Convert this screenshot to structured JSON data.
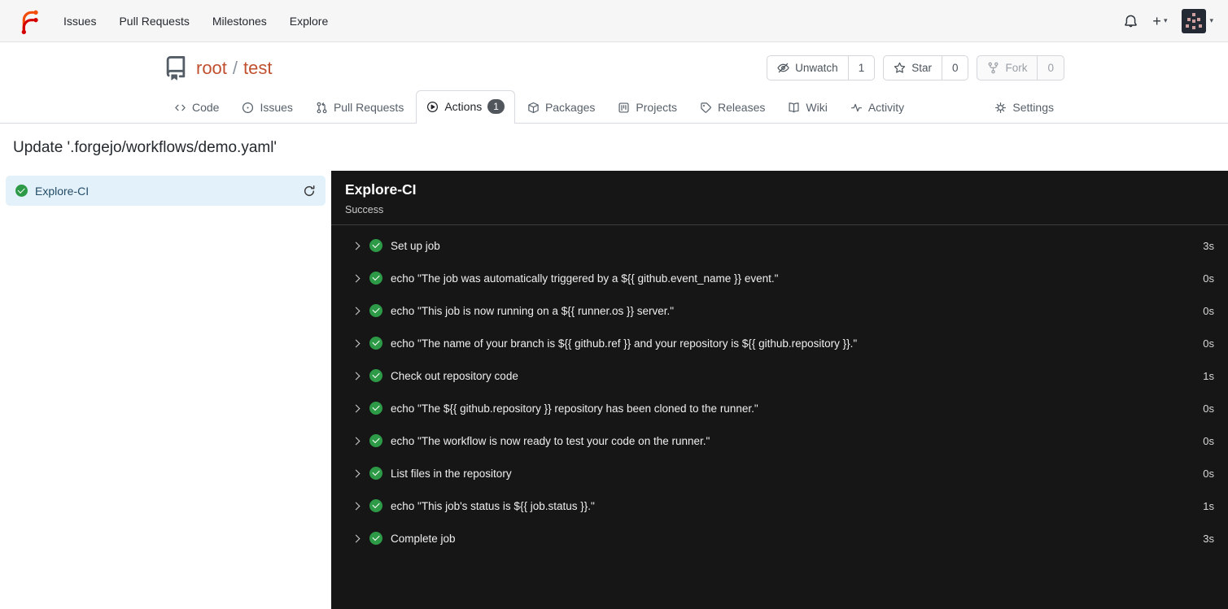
{
  "icons": {
    "caret_down": "▾",
    "plus": "+"
  },
  "navbar": {
    "items": [
      {
        "label": "Issues"
      },
      {
        "label": "Pull Requests"
      },
      {
        "label": "Milestones"
      },
      {
        "label": "Explore"
      }
    ]
  },
  "repo": {
    "owner": "root",
    "separator": "/",
    "name": "test"
  },
  "repo_actions": {
    "unwatch": {
      "label": "Unwatch",
      "count": "1"
    },
    "star": {
      "label": "Star",
      "count": "0"
    },
    "fork": {
      "label": "Fork",
      "count": "0"
    }
  },
  "tabs": [
    {
      "label": "Code"
    },
    {
      "label": "Issues"
    },
    {
      "label": "Pull Requests"
    },
    {
      "label": "Actions",
      "badge": "1"
    },
    {
      "label": "Packages"
    },
    {
      "label": "Projects"
    },
    {
      "label": "Releases"
    },
    {
      "label": "Wiki"
    },
    {
      "label": "Activity"
    },
    {
      "label": "Settings"
    }
  ],
  "run": {
    "title": "Update '.forgejo/workflows/demo.yaml'",
    "jobs": [
      {
        "name": "Explore-CI",
        "status": "success"
      }
    ],
    "detail": {
      "title": "Explore-CI",
      "status": "Success",
      "steps": [
        {
          "label": "Set up job",
          "duration": "3s"
        },
        {
          "label": "echo \"The job was automatically triggered by a ${{ github.event_name }} event.\"",
          "duration": "0s"
        },
        {
          "label": "echo \"This job is now running on a ${{ runner.os }} server.\"",
          "duration": "0s"
        },
        {
          "label": "echo \"The name of your branch is ${{ github.ref }} and your repository is ${{ github.repository }}.\"",
          "duration": "0s"
        },
        {
          "label": "Check out repository code",
          "duration": "1s"
        },
        {
          "label": "echo \"The ${{ github.repository }} repository has been cloned to the runner.\"",
          "duration": "0s"
        },
        {
          "label": "echo \"The workflow is now ready to test your code on the runner.\"",
          "duration": "0s"
        },
        {
          "label": "List files in the repository",
          "duration": "0s"
        },
        {
          "label": "echo \"This job's status is ${{ job.status }}.\"",
          "duration": "1s"
        },
        {
          "label": "Complete job",
          "duration": "3s"
        }
      ]
    }
  },
  "colors": {
    "brand_orange": "#f34d0c",
    "brand_red": "#d40000",
    "repo_title": "#c0502f",
    "success_green": "#2c9a46",
    "panel_dark": "#161616",
    "job_selected_bg": "#e3f1fa"
  }
}
